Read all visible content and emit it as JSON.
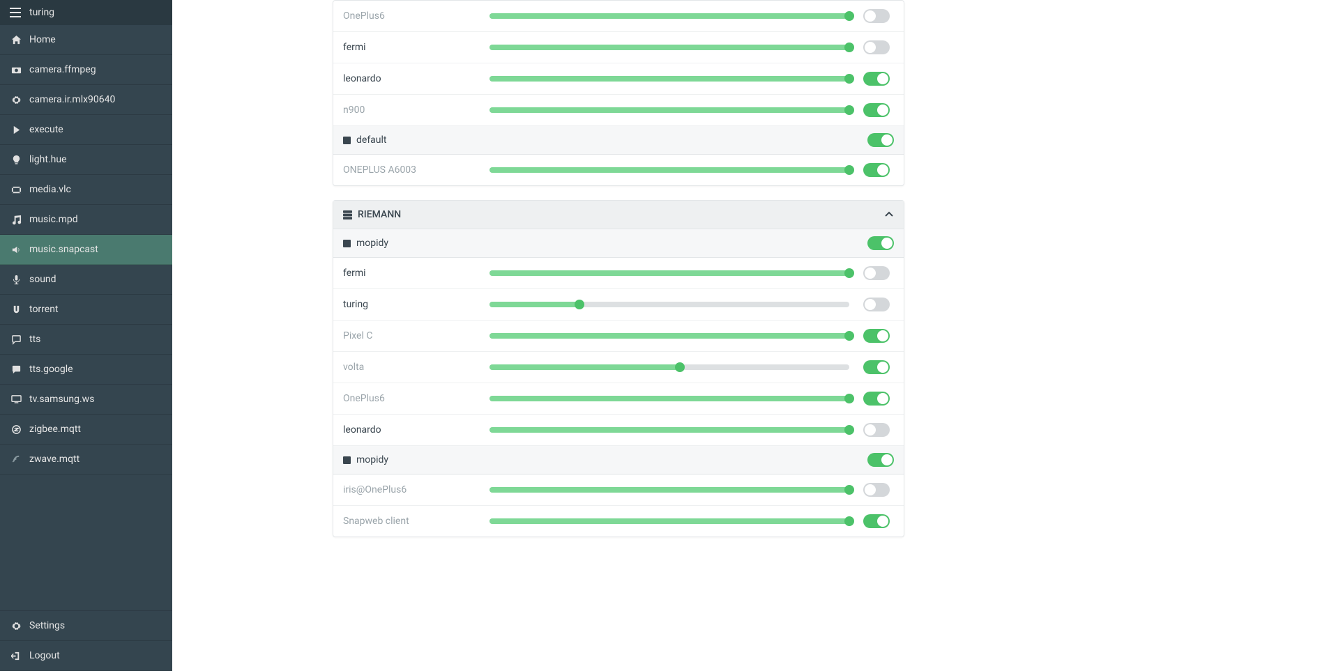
{
  "sidebar": {
    "title": "turing",
    "items": [
      {
        "icon": "home",
        "label": "Home",
        "active": false
      },
      {
        "icon": "camera",
        "label": "camera.ffmpeg",
        "active": false
      },
      {
        "icon": "gear",
        "label": "camera.ir.mlx90640",
        "active": false
      },
      {
        "icon": "play",
        "label": "execute",
        "active": false
      },
      {
        "icon": "bulb",
        "label": "light.hue",
        "active": false
      },
      {
        "icon": "film",
        "label": "media.vlc",
        "active": false
      },
      {
        "icon": "music",
        "label": "music.mpd",
        "active": false
      },
      {
        "icon": "volume",
        "label": "music.snapcast",
        "active": true
      },
      {
        "icon": "mic",
        "label": "sound",
        "active": false
      },
      {
        "icon": "magnet",
        "label": "torrent",
        "active": false
      },
      {
        "icon": "chat",
        "label": "tts",
        "active": false
      },
      {
        "icon": "chatfill",
        "label": "tts.google",
        "active": false
      },
      {
        "icon": "monitor",
        "label": "tv.samsung.ws",
        "active": false
      },
      {
        "icon": "zigbee",
        "label": "zigbee.mqtt",
        "active": false,
        "dim": true
      },
      {
        "icon": "zwave",
        "label": "zwave.mqtt",
        "active": false,
        "dim": true
      }
    ],
    "footer": [
      {
        "icon": "gear",
        "label": "Settings"
      },
      {
        "icon": "logout",
        "label": "Logout"
      }
    ]
  },
  "servers": [
    {
      "name": "",
      "partial_top": true,
      "groups": [
        {
          "name": "",
          "toggle": null,
          "pre_clients": [
            {
              "name": "OnePlus6",
              "dim": true,
              "volume": 100,
              "toggle": false
            },
            {
              "name": "fermi",
              "dim": false,
              "volume": 100,
              "toggle": false
            },
            {
              "name": "leonardo",
              "dim": false,
              "volume": 100,
              "toggle": true
            },
            {
              "name": "n900",
              "dim": true,
              "volume": 100,
              "toggle": true
            }
          ]
        },
        {
          "name": "default",
          "toggle": true,
          "clients": [
            {
              "name": "ONEPLUS A6003",
              "dim": true,
              "volume": 100,
              "toggle": true
            }
          ]
        }
      ]
    },
    {
      "name": "RIEMANN",
      "groups": [
        {
          "name": "mopidy",
          "toggle": true,
          "clients": [
            {
              "name": "fermi",
              "dim": false,
              "volume": 100,
              "toggle": false
            },
            {
              "name": "turing",
              "dim": false,
              "volume": 25,
              "toggle": false
            },
            {
              "name": "Pixel C",
              "dim": true,
              "volume": 100,
              "toggle": true
            },
            {
              "name": "volta",
              "dim": true,
              "volume": 53,
              "toggle": true
            },
            {
              "name": "OnePlus6",
              "dim": true,
              "volume": 100,
              "toggle": true
            },
            {
              "name": "leonardo",
              "dim": false,
              "volume": 100,
              "toggle": false
            }
          ]
        },
        {
          "name": "mopidy",
          "toggle": true,
          "clients": [
            {
              "name": "iris@OnePlus6",
              "dim": true,
              "volume": 100,
              "toggle": false
            },
            {
              "name": "Snapweb client",
              "dim": true,
              "volume": 100,
              "toggle": true
            }
          ]
        }
      ]
    }
  ]
}
